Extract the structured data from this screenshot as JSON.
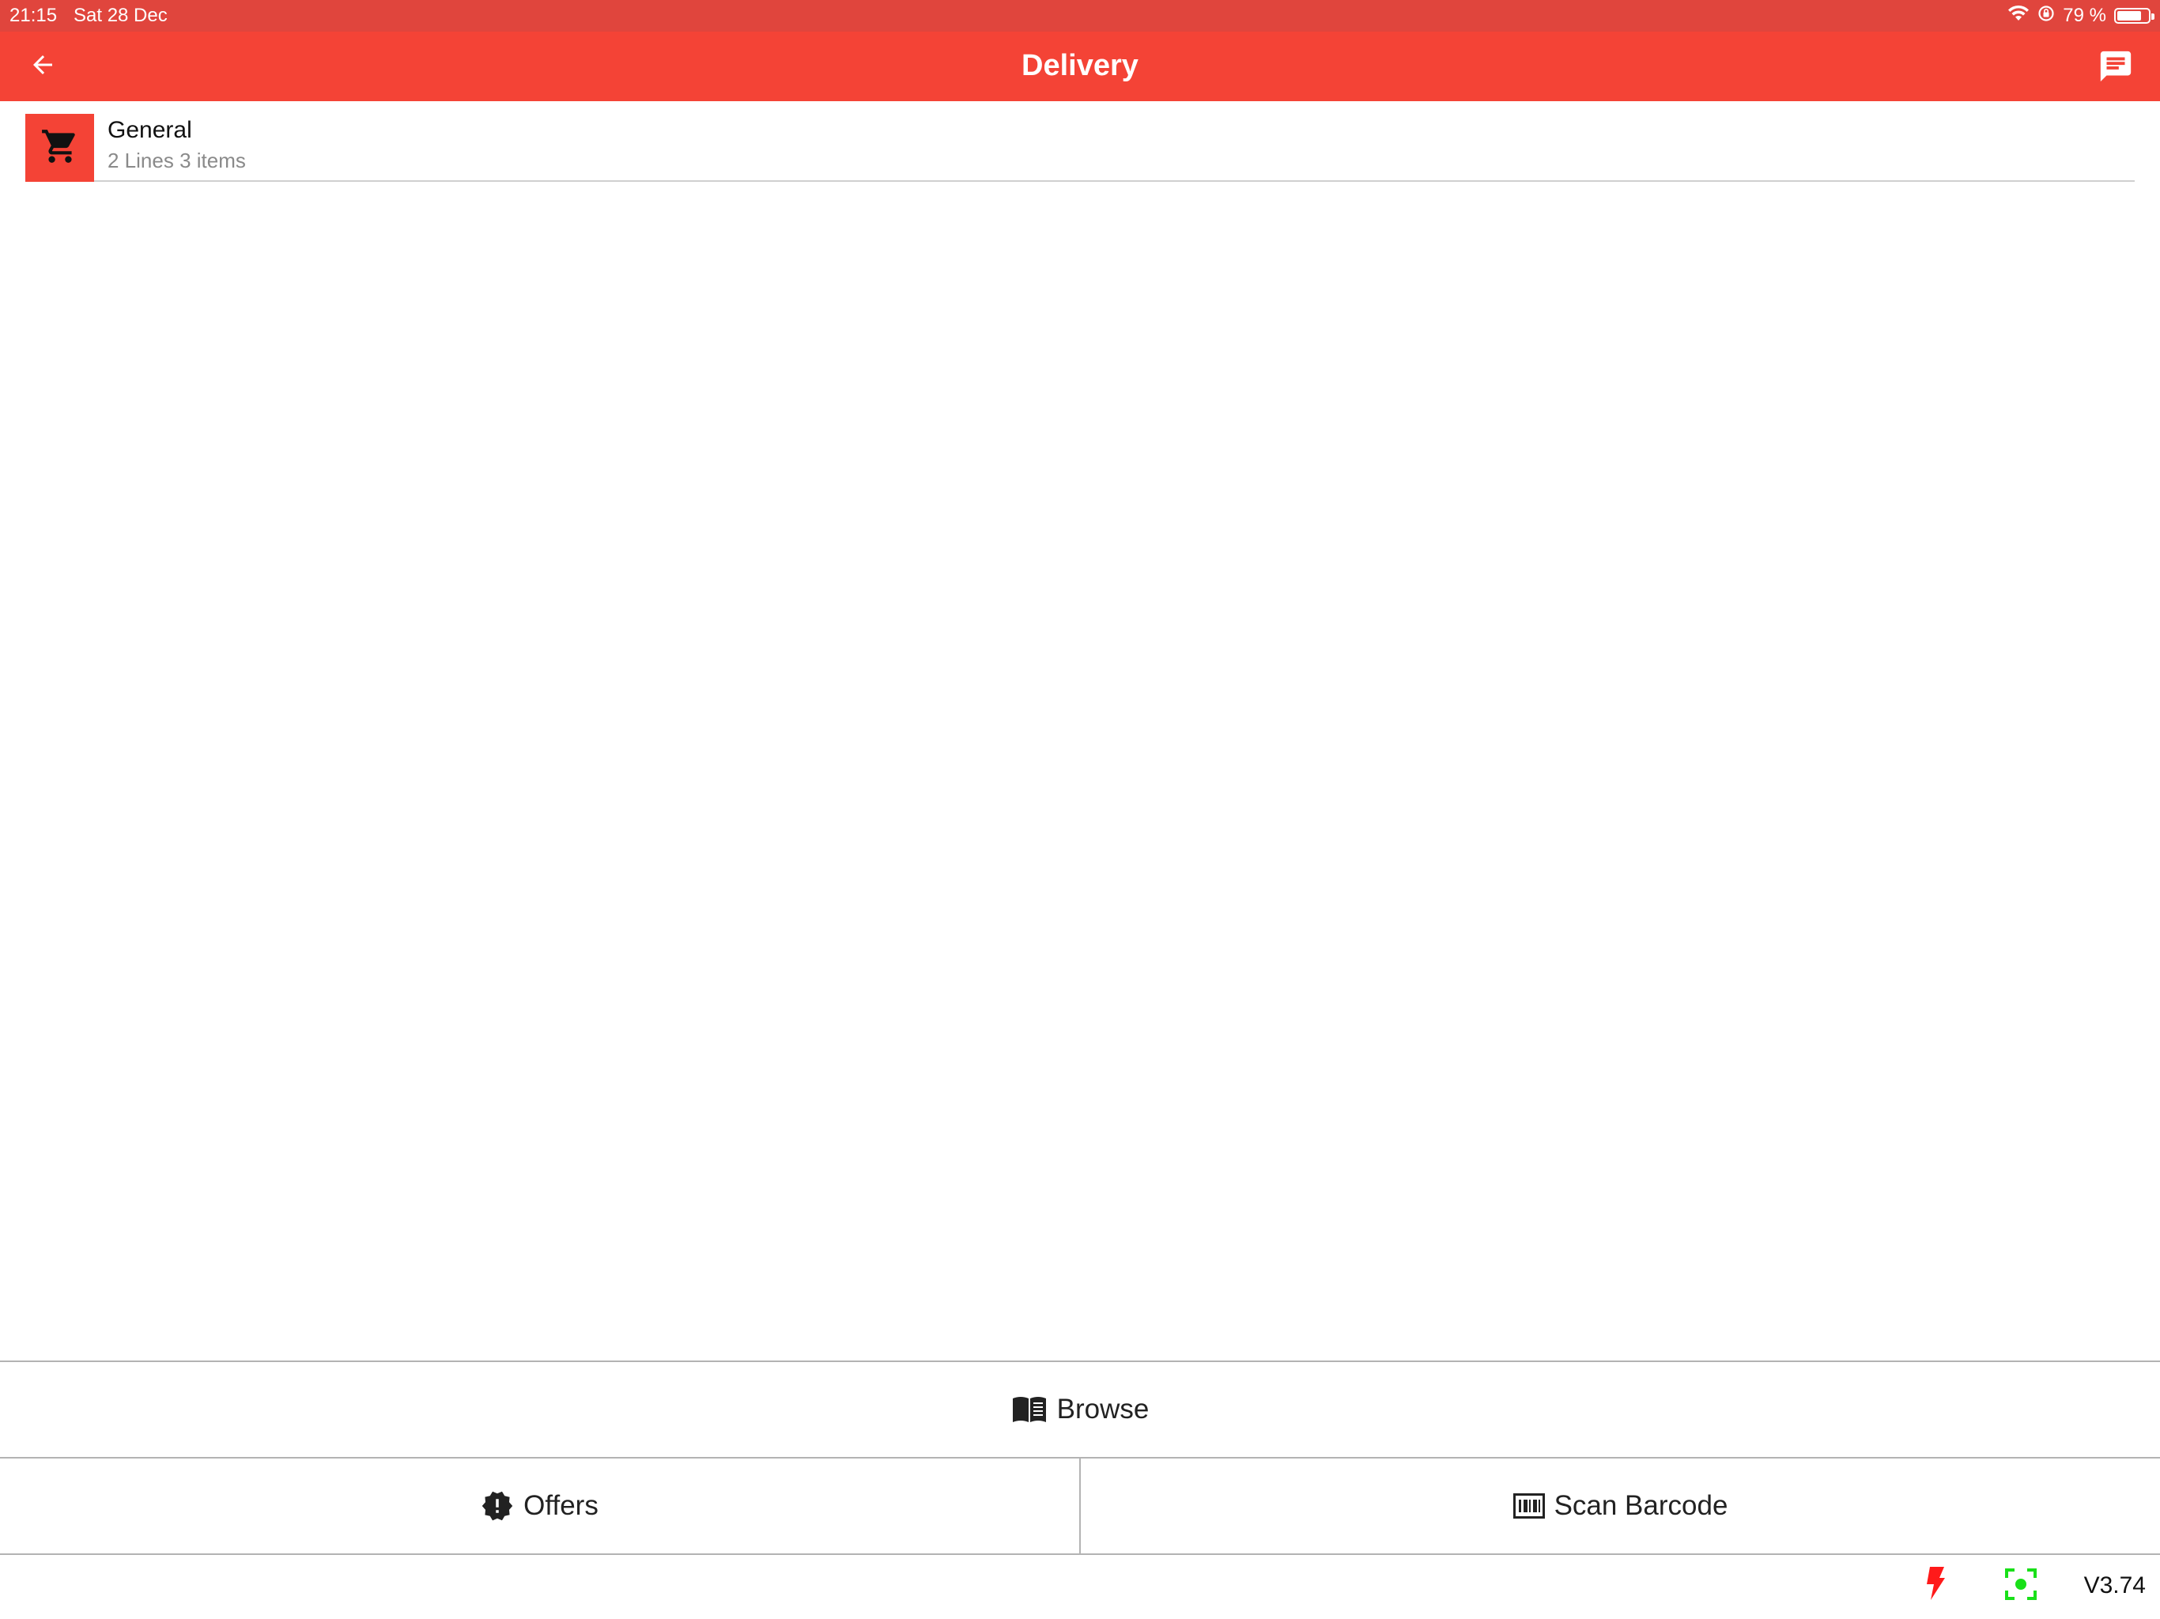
{
  "status_bar": {
    "time": "21:15",
    "date": "Sat 28 Dec",
    "battery": "79 %",
    "battery_level": 0.79,
    "icons": [
      "wifi-icon",
      "orientation-lock-icon",
      "battery-icon"
    ]
  },
  "header": {
    "title": "Delivery",
    "back_icon": "arrow-left-icon",
    "message_icon": "message-icon",
    "background": "#f44336"
  },
  "list": {
    "items": [
      {
        "name": "General",
        "subtitle": "2 Lines 3 items",
        "icon": "shopping-cart-icon"
      }
    ]
  },
  "actions": {
    "browse": {
      "label": "Browse",
      "icon": "open-book-icon"
    },
    "offers": {
      "label": "Offers",
      "icon": "alert-badge-icon"
    },
    "scan": {
      "label": "Scan Barcode",
      "icon": "barcode-icon"
    }
  },
  "footer": {
    "flash_icon": "flash-icon",
    "flash_color": "#ff1a1a",
    "scanner_icon": "scanner-focus-icon",
    "scanner_color": "#19e019",
    "version": "V3.74"
  }
}
